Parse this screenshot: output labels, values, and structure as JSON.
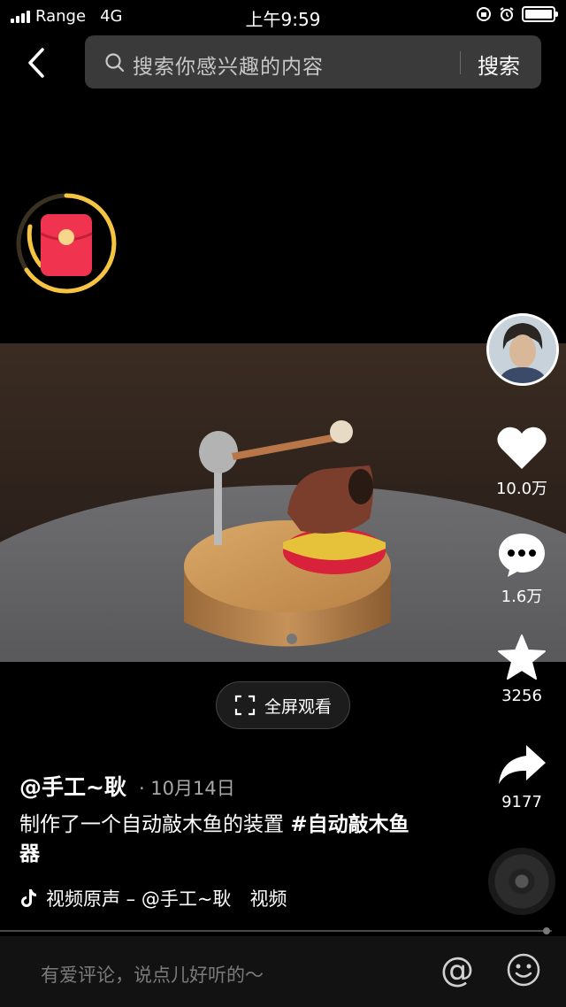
{
  "status_bar": {
    "carrier": "Range",
    "network": "4G",
    "time": "上午9:59"
  },
  "search": {
    "placeholder": "搜索你感兴趣的内容",
    "button_label": "搜索"
  },
  "video": {
    "fullscreen_label": "全屏观看"
  },
  "actions": {
    "likes": "10.0万",
    "comments": "1.6万",
    "favorites": "3256",
    "shares": "9177"
  },
  "post": {
    "author": "@手工~耿",
    "date": "· 10月14日",
    "description": "制作了一个自动敲木鱼的装置 ",
    "hashtag": "#自动敲木鱼器",
    "music": "视频原声 – @手工~耿　视频"
  },
  "comment_bar": {
    "placeholder": "有爱评论，说点儿好听的～"
  },
  "colors": {
    "background": "#000000",
    "search_bg": "#3a3a3a",
    "red_packet": "#f0344f",
    "ring": "#f5c542"
  }
}
